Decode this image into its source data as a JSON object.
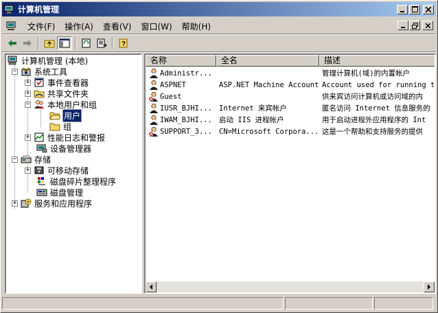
{
  "window": {
    "title": "计算机管理"
  },
  "menu": {
    "items": [
      {
        "label": "文件(F)"
      },
      {
        "label": "操作(A)"
      },
      {
        "label": "查看(V)"
      },
      {
        "label": "窗口(W)"
      },
      {
        "label": "帮助(H)"
      }
    ]
  },
  "tree": {
    "root": "计算机管理 (本地)",
    "system_tools": "系统工具",
    "event_viewer": "事件查看器",
    "shared_folders": "共享文件夹",
    "local_users_groups": "本地用户和组",
    "users": "用户",
    "groups": "组",
    "perf_logs": "性能日志和警报",
    "device_manager": "设备管理器",
    "storage": "存储",
    "removable_storage": "可移动存储",
    "defrag": "磁盘碎片整理程序",
    "disk_mgmt": "磁盘管理",
    "services_apps": "服务和应用程序"
  },
  "list": {
    "columns": [
      "名称",
      "全名",
      "描述"
    ],
    "rows": [
      {
        "name": "Administr...",
        "full": "",
        "desc": "管理计算机(域)的内置帐户",
        "disabled": false
      },
      {
        "name": "ASPNET",
        "full": "ASP.NET Machine Account",
        "desc": "Account used for running the",
        "disabled": false
      },
      {
        "name": "Guest",
        "full": "",
        "desc": "供来宾访问计算机或访问域的内",
        "disabled": true
      },
      {
        "name": "IUSR_BJHI...",
        "full": "Internet 来宾帐户",
        "desc": "匿名访问 Internet 信息服务的",
        "disabled": false
      },
      {
        "name": "IWAM_BJHI...",
        "full": "启动 IIS 进程帐户",
        "desc": "用于启动进程外应用程序的 Int",
        "disabled": false
      },
      {
        "name": "SUPPORT_3...",
        "full": "CN=Microsoft Corpora...",
        "desc": "这是一个帮助和支持服务的提供",
        "disabled": true
      }
    ]
  }
}
